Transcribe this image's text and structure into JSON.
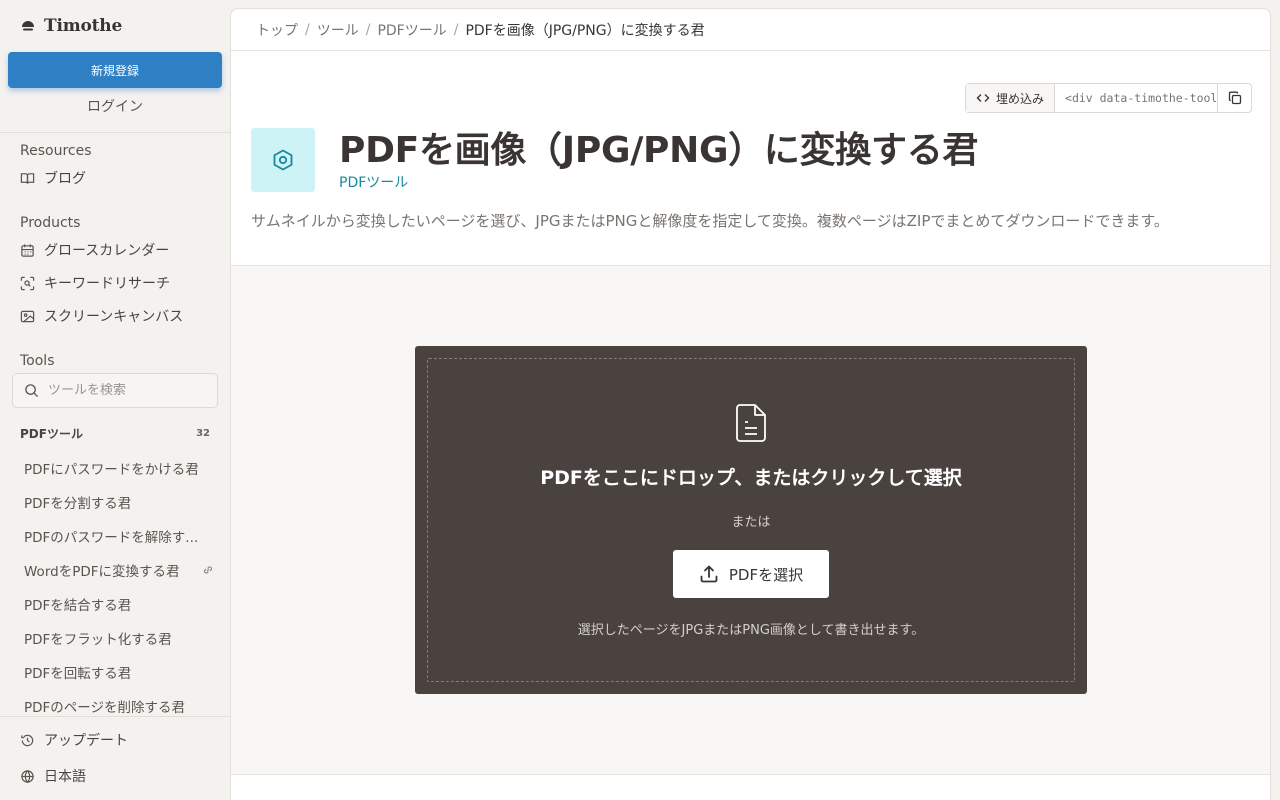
{
  "sidebar": {
    "logo_text": "Timothe",
    "signup_label": "新規登録",
    "login_label": "ログイン",
    "resources": {
      "title": "Resources",
      "items": [
        {
          "label": "ブログ",
          "icon": "book-icon"
        }
      ]
    },
    "products": {
      "title": "Products",
      "items": [
        {
          "label": "グロースカレンダー",
          "icon": "calendar-icon"
        },
        {
          "label": "キーワードリサーチ",
          "icon": "scan-search-icon"
        },
        {
          "label": "スクリーンキャンバス",
          "icon": "image-icon"
        }
      ]
    },
    "tools": {
      "title": "Tools",
      "search_placeholder": "ツールを検索",
      "category": {
        "title": "PDFツール",
        "count": "32"
      },
      "items": [
        {
          "label": "PDFにパスワードをかける君"
        },
        {
          "label": "PDFを分割する君"
        },
        {
          "label": "PDFのパスワードを解除す..."
        },
        {
          "label": "WordをPDFに変換する君",
          "badge_icon": "link-icon"
        },
        {
          "label": "PDFを結合する君"
        },
        {
          "label": "PDFをフラット化する君"
        },
        {
          "label": "PDFを回転する君"
        },
        {
          "label": "PDFのページを削除する君"
        }
      ]
    },
    "bottom": {
      "updates_label": "アップデート",
      "language_label": "日本語"
    }
  },
  "breadcrumb": {
    "items": [
      "トップ",
      "ツール",
      "PDFツール"
    ],
    "current": "PDFを画像（JPG/PNG）に変換する君"
  },
  "embed": {
    "button_label": "埋め込み",
    "code": "<div data-timothe-tool=\"pdf-to-image\"></div>"
  },
  "tool": {
    "title": "PDFを画像（JPG/PNG）に変換する君",
    "category_link": "PDFツール",
    "description": "サムネイルから変換したいページを選び、JPGまたはPNGと解像度を指定して変換。複数ページはZIPでまとめてダウンロードできます。",
    "icon": "hexagon-gear-icon",
    "accent_color": "#19889a",
    "icon_bg": "#cdf3f6"
  },
  "dropzone": {
    "title": "PDFをここにドロップ、またはクリックして選択",
    "or_label": "または",
    "select_button": "PDFを選択",
    "note": "選択したページをJPGまたはPNG画像として書き出せます。",
    "bg_color": "#4a423e"
  },
  "colors": {
    "primary_button": "#2e7fc4",
    "sidebar_bg": "#f4f2ef"
  }
}
